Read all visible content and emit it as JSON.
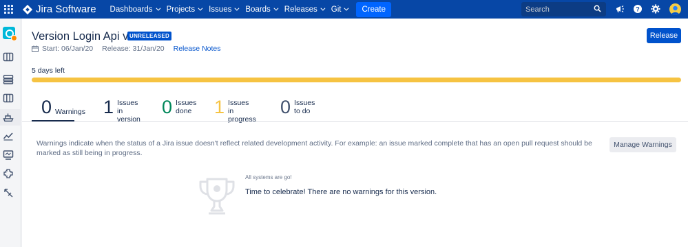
{
  "nav": {
    "app_switcher_icon": "app-switcher-grid-icon",
    "logo_text": "Jira Software",
    "items": [
      {
        "label": "Dashboards"
      },
      {
        "label": "Projects"
      },
      {
        "label": "Issues"
      },
      {
        "label": "Boards"
      },
      {
        "label": "Releases"
      },
      {
        "label": "Git"
      }
    ],
    "create_label": "Create",
    "search_placeholder": "Search",
    "icons": [
      "search-icon",
      "megaphone-icon",
      "help-icon",
      "settings-icon",
      "user-avatar"
    ]
  },
  "sidebar": {
    "icons": [
      "project-avatar",
      "board-icon",
      "backlog-icon",
      "kanban-icon",
      "releases-icon",
      "reports-icon",
      "monitor-icon",
      "components-icon",
      "add-on-icon"
    ]
  },
  "version": {
    "title": "Version Login Api v2",
    "status": "UNRELEASED",
    "start": "Start: 06/Jan/20",
    "release_date": "Release: 31/Jan/20",
    "notes_link": "Release Notes",
    "release_button": "Release",
    "days_left": "5 days left",
    "progress_fraction": 1.0
  },
  "tabs": [
    {
      "num": "0",
      "label_1": "Warnings",
      "label_2": "",
      "color": "#172b4d"
    },
    {
      "num": "1",
      "label_1": "Issues in",
      "label_2": "version",
      "color": "#172b4d"
    },
    {
      "num": "0",
      "label_1": "Issues",
      "label_2": "done",
      "color": "#00875a"
    },
    {
      "num": "1",
      "label_1": "Issues",
      "label_2": "in progress",
      "color": "#f6c342"
    },
    {
      "num": "0",
      "label_1": "Issues",
      "label_2": "to do",
      "color": "#42526e"
    }
  ],
  "warnings": {
    "description": "Warnings indicate when the status of a Jira issue doesn't reflect related development activity. For example: an issue marked complete that has an open pull request should be marked as still being in progress.",
    "manage_button": "Manage Warnings",
    "heading": "All systems are go!",
    "message": "Time to celebrate! There are no warnings for this version."
  }
}
